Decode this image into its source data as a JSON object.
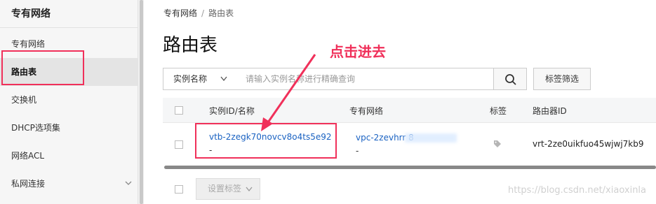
{
  "sidebar": {
    "title": "专有网络",
    "items": [
      {
        "label": "专有网络"
      },
      {
        "label": "路由表"
      },
      {
        "label": "交换机"
      },
      {
        "label": "DHCP选项集"
      },
      {
        "label": "网络ACL"
      },
      {
        "label": "私网连接"
      }
    ]
  },
  "breadcrumb": {
    "parent": "专有网络",
    "separator": "/",
    "current": "路由表"
  },
  "page_title": "路由表",
  "toolbar": {
    "select_value": "实例名称",
    "search_placeholder": "请输入实例名称进行精确查询",
    "filter_label": "标签筛选"
  },
  "table": {
    "columns": [
      "实例ID/名称",
      "专有网络",
      "标签",
      "路由器ID"
    ],
    "rows": [
      {
        "instance_id": "vtb-2zegk70novcv8o4ts5e92",
        "instance_name": "-",
        "vpc": "vpc-2zevhrr          8",
        "vpc_name": "-",
        "router_id": "vrt-2ze0uikfuo45wjwj7kb9"
      }
    ]
  },
  "footer": {
    "set_tag_label": "设置标签"
  },
  "annotation": {
    "text": "点击进去",
    "color": "#f0305a"
  },
  "watermark": "https://blog.csdn.net/xiaoxinla"
}
